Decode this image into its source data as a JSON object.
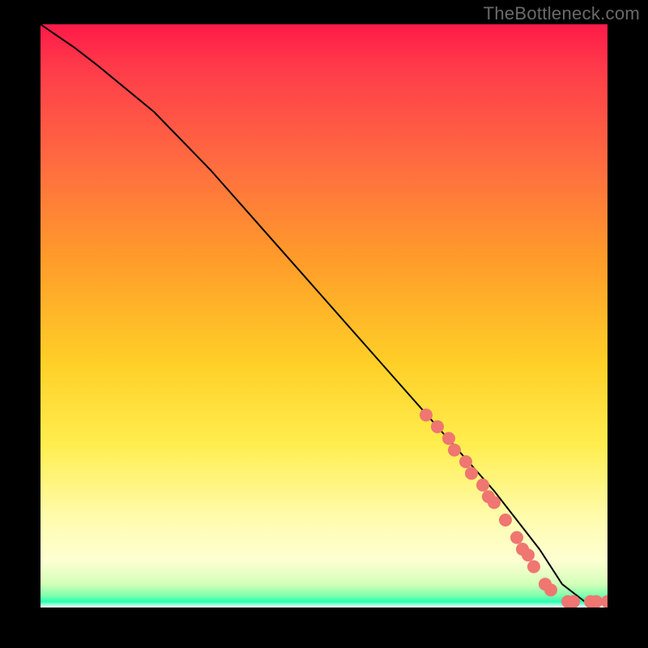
{
  "attribution": "TheBottleneck.com",
  "chart_data": {
    "type": "line",
    "title": "",
    "xlabel": "",
    "ylabel": "",
    "xlim": [
      0,
      100
    ],
    "ylim": [
      0,
      100
    ],
    "grid": false,
    "legend": false,
    "series": [
      {
        "name": "curve",
        "style": "line-thin-black",
        "x": [
          0,
          3,
          6,
          10,
          15,
          20,
          30,
          40,
          50,
          60,
          70,
          80,
          88,
          92,
          96,
          100
        ],
        "y": [
          100,
          98,
          96,
          93,
          89,
          85,
          75,
          64,
          53,
          42,
          31,
          20,
          10,
          4,
          1,
          0.5
        ]
      },
      {
        "name": "highlight-dots",
        "style": "dots-salmon",
        "x": [
          68,
          70,
          72,
          73,
          75,
          76,
          78,
          79,
          80,
          82,
          84,
          85,
          86,
          87,
          89,
          90,
          93,
          94,
          97,
          98,
          100
        ],
        "y": [
          33,
          31,
          29,
          27,
          25,
          23,
          21,
          19,
          18,
          15,
          12,
          10,
          9,
          7,
          4,
          3,
          1,
          1,
          1,
          1,
          1
        ]
      }
    ],
    "background_gradient": {
      "stops": [
        {
          "pos": 0,
          "color": "#ff1a48"
        },
        {
          "pos": 8,
          "color": "#ff3d4a"
        },
        {
          "pos": 25,
          "color": "#ff6f3f"
        },
        {
          "pos": 40,
          "color": "#ff9b2a"
        },
        {
          "pos": 58,
          "color": "#ffcf27"
        },
        {
          "pos": 72,
          "color": "#ffee4e"
        },
        {
          "pos": 85,
          "color": "#fffcb0"
        },
        {
          "pos": 92,
          "color": "#fdffd2"
        },
        {
          "pos": 96,
          "color": "#d3ffb9"
        },
        {
          "pos": 98,
          "color": "#7dffad"
        },
        {
          "pos": 99,
          "color": "#2affb4"
        },
        {
          "pos": 100,
          "color": "#ffffff"
        }
      ]
    }
  },
  "colors": {
    "line": "#000000",
    "dots": "#ef7671",
    "frame": "#000000"
  }
}
